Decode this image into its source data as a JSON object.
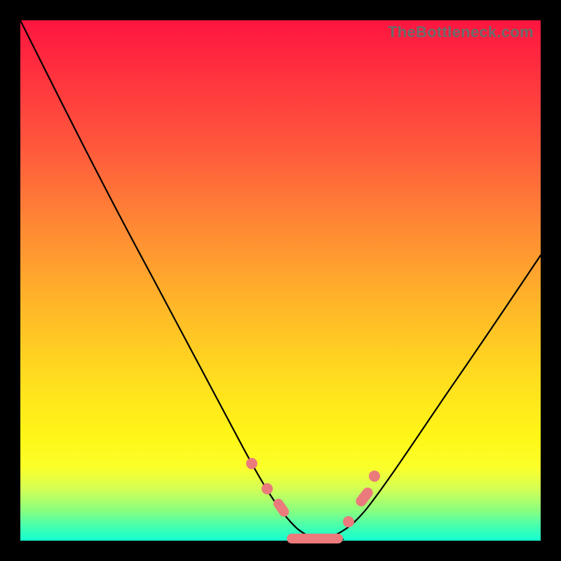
{
  "watermark": "TheBottleneck.com",
  "colors": {
    "page_bg": "#000000",
    "gradient_top": "#ff153f",
    "gradient_mid1": "#ff8a34",
    "gradient_mid2": "#ffe01e",
    "gradient_bottom": "#12ffd1",
    "curve": "#000000",
    "marker": "#ea7a7b"
  },
  "chart_data": {
    "type": "line",
    "title": "",
    "xlabel": "",
    "ylabel": "",
    "xlim": [
      0,
      100
    ],
    "ylim": [
      0,
      100
    ],
    "note": "No axis ticks or numeric labels are rendered in the image; x expressed as 0–100 horizontal position, y as 0 (bottom) to 100 (top). Values are visual estimates from the plot.",
    "series": [
      {
        "name": "left_curve",
        "x": [
          0,
          5,
          10,
          15,
          20,
          25,
          30,
          35,
          40,
          45,
          48,
          50,
          52,
          54,
          56,
          58,
          60
        ],
        "y": [
          100,
          92,
          83,
          74,
          65,
          55,
          45,
          35,
          26,
          17,
          12,
          9,
          6,
          4,
          2.5,
          1.5,
          1
        ]
      },
      {
        "name": "right_curve",
        "x": [
          55,
          58,
          60,
          62,
          65,
          70,
          75,
          80,
          85,
          90,
          95,
          100
        ],
        "y": [
          1,
          1.5,
          2.5,
          4,
          7,
          14,
          22,
          30,
          38,
          45,
          52,
          58
        ]
      },
      {
        "name": "bottom_flat_segment",
        "x": [
          50,
          52,
          54,
          56,
          58,
          60,
          62
        ],
        "y": [
          1,
          1,
          1,
          1,
          1,
          1,
          1
        ]
      }
    ],
    "markers": [
      {
        "shape": "circle",
        "x": 44,
        "y": 15
      },
      {
        "shape": "circle",
        "x": 47,
        "y": 10
      },
      {
        "shape": "pill",
        "x": 49,
        "y": 6,
        "orientation": "diag-down"
      },
      {
        "shape": "pill",
        "x": 56,
        "y": 1,
        "orientation": "horizontal",
        "length": 10
      },
      {
        "shape": "circle",
        "x": 63,
        "y": 4
      },
      {
        "shape": "pill",
        "x": 65,
        "y": 8,
        "orientation": "diag-up"
      },
      {
        "shape": "circle",
        "x": 67,
        "y": 12
      }
    ]
  }
}
